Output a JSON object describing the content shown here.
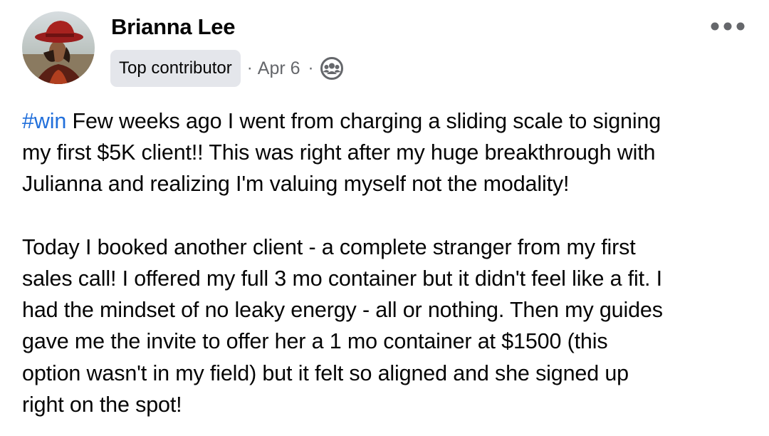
{
  "author": {
    "name": "Brianna Lee",
    "badge": "Top contributor"
  },
  "meta": {
    "separator": "·",
    "date": "Apr 6",
    "audience_icon": "group-icon"
  },
  "header": {
    "more_icon": "more-horizontal-icon"
  },
  "post": {
    "hashtag": "#win",
    "para1_lines": [
      " Few weeks ago I went from charging a sliding scale to signing",
      "my first $5K client!! This was right after my huge breakthrough with",
      "Julianna and realizing I'm valuing myself not the modality!"
    ],
    "para2_lines": [
      "Today I booked another client - a complete stranger from my first",
      "sales call! I offered my full 3 mo container but it didn't feel like a fit. I",
      "had the mindset of no leaky energy - all or nothing. Then my guides",
      "gave me the invite to offer her a 1 mo container at $1500 (this",
      "option wasn't in my field) but it felt so aligned and she signed up",
      "right on the spot!"
    ]
  },
  "colors": {
    "link": "#216fdb",
    "secondary_text": "#65676b",
    "badge_bg": "#e4e6eb"
  }
}
